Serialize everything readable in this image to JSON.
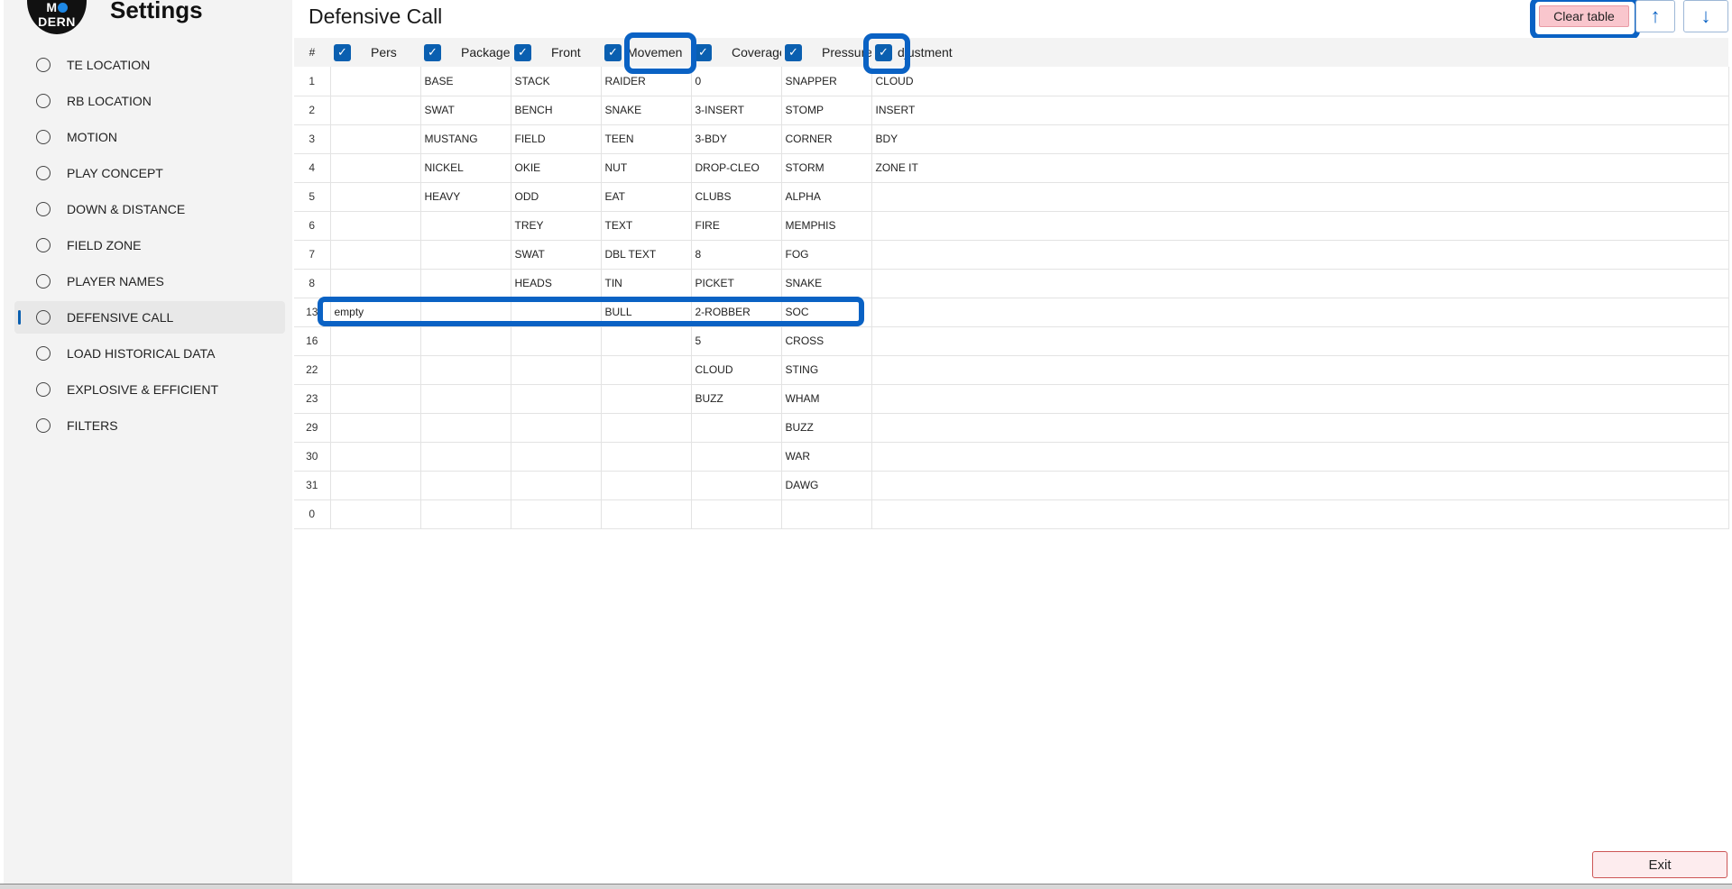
{
  "sidebar": {
    "logo_text_pre": "M",
    "logo_text_post": "DERN",
    "title": "Settings",
    "items": [
      {
        "label": "TE LOCATION"
      },
      {
        "label": "RB LOCATION"
      },
      {
        "label": "MOTION"
      },
      {
        "label": "PLAY CONCEPT"
      },
      {
        "label": "DOWN & DISTANCE"
      },
      {
        "label": "FIELD ZONE"
      },
      {
        "label": "PLAYER NAMES"
      },
      {
        "label": "DEFENSIVE CALL",
        "active": true
      },
      {
        "label": "LOAD HISTORICAL DATA"
      },
      {
        "label": "EXPLOSIVE & EFFICIENT"
      },
      {
        "label": "FILTERS"
      }
    ]
  },
  "main": {
    "title": "Defensive Call",
    "clear_label": "Clear table",
    "up_icon": "↑",
    "down_icon": "↓",
    "exit_label": "Exit",
    "accent": "#0a5fb0",
    "highlight": "#0a62c4"
  },
  "table": {
    "num_header": "#",
    "columns": [
      "Pers",
      "Package",
      "Front",
      "Movemen",
      "Coverage",
      "Pressure",
      "djustment"
    ],
    "rows": [
      {
        "num": "1",
        "cells": [
          "",
          "BASE",
          "STACK",
          "RAIDER",
          "0",
          "SNAPPER",
          "CLOUD"
        ]
      },
      {
        "num": "2",
        "cells": [
          "",
          "SWAT",
          "BENCH",
          "SNAKE",
          "3-INSERT",
          "STOMP",
          "INSERT"
        ]
      },
      {
        "num": "3",
        "cells": [
          "",
          "MUSTANG",
          "FIELD",
          "TEEN",
          "3-BDY",
          "CORNER",
          "BDY"
        ]
      },
      {
        "num": "4",
        "cells": [
          "",
          "NICKEL",
          "OKIE",
          "NUT",
          "DROP-CLEO",
          "STORM",
          "ZONE IT"
        ]
      },
      {
        "num": "5",
        "cells": [
          "",
          "HEAVY",
          "ODD",
          "EAT",
          "CLUBS",
          "ALPHA",
          ""
        ]
      },
      {
        "num": "6",
        "cells": [
          "",
          "",
          "TREY",
          "TEXT",
          "FIRE",
          "MEMPHIS",
          ""
        ]
      },
      {
        "num": "7",
        "cells": [
          "",
          "",
          "SWAT",
          "DBL TEXT",
          "8",
          "FOG",
          ""
        ]
      },
      {
        "num": "8",
        "cells": [
          "",
          "",
          "HEADS",
          "TIN",
          "PICKET",
          "SNAKE",
          ""
        ]
      },
      {
        "num": "13",
        "cells": [
          "empty",
          "",
          "",
          "BULL",
          "2-ROBBER",
          "SOC",
          ""
        ],
        "selected": true
      },
      {
        "num": "16",
        "cells": [
          "",
          "",
          "",
          "",
          "5",
          "CROSS",
          ""
        ]
      },
      {
        "num": "22",
        "cells": [
          "",
          "",
          "",
          "",
          "CLOUD",
          "STING",
          ""
        ]
      },
      {
        "num": "23",
        "cells": [
          "",
          "",
          "",
          "",
          "BUZZ",
          "WHAM",
          ""
        ]
      },
      {
        "num": "29",
        "cells": [
          "",
          "",
          "",
          "",
          "",
          "BUZZ",
          ""
        ]
      },
      {
        "num": "30",
        "cells": [
          "",
          "",
          "",
          "",
          "",
          "WAR",
          ""
        ]
      },
      {
        "num": "31",
        "cells": [
          "",
          "",
          "",
          "",
          "",
          "DAWG",
          ""
        ]
      },
      {
        "num": "0",
        "cells": [
          "",
          "",
          "",
          "",
          "",
          "",
          ""
        ]
      }
    ]
  }
}
